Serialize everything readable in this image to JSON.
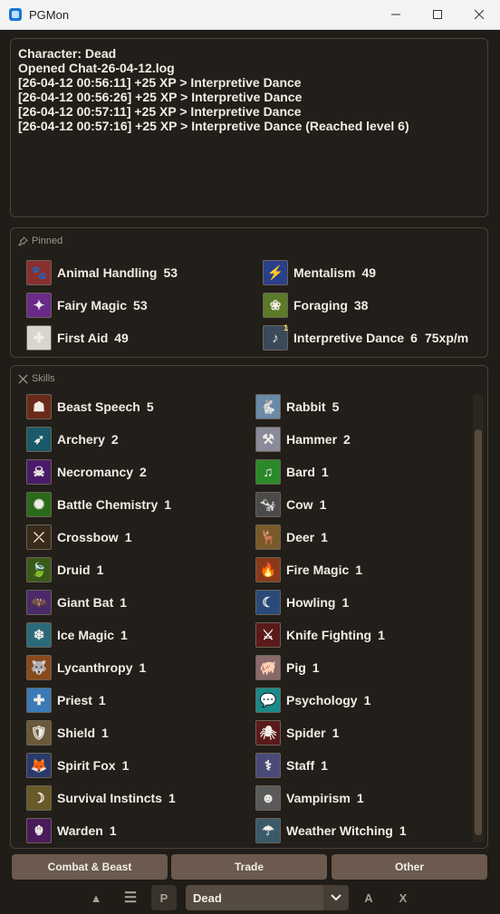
{
  "window": {
    "title": "PGMon"
  },
  "log": {
    "lines": [
      "Character: Dead",
      "Opened Chat-26-04-12.log",
      "[26-04-12 00:56:11] +25 XP > Interpretive Dance",
      "[26-04-12 00:56:26] +25 XP > Interpretive Dance",
      "[26-04-12 00:57:11] +25 XP > Interpretive Dance",
      "[26-04-12 00:57:16] +25 XP > Interpretive Dance (Reached level 6)"
    ]
  },
  "pinned": {
    "title": "Pinned",
    "items": [
      {
        "name": "Animal Handling",
        "level": "53",
        "icon": "animal-handling-icon",
        "color": "#8a2f2f",
        "glyph": "🐾"
      },
      {
        "name": "Mentalism",
        "level": "49",
        "icon": "mentalism-icon",
        "color": "#2a3f8a",
        "glyph": "⚡"
      },
      {
        "name": "Fairy Magic",
        "level": "53",
        "icon": "fairy-magic-icon",
        "color": "#6a2a8a",
        "glyph": "✦"
      },
      {
        "name": "Foraging",
        "level": "38",
        "icon": "foraging-icon",
        "color": "#5b7a2a",
        "glyph": "❀"
      },
      {
        "name": "First Aid",
        "level": "49",
        "icon": "first-aid-icon",
        "color": "#d9d4cc",
        "glyph": "✚"
      },
      {
        "name": "Interpretive Dance",
        "level": "6",
        "rate": "75xp/m",
        "badge": "1",
        "icon": "interpretive-dance-icon",
        "color": "#3a4a5a",
        "glyph": "♪"
      }
    ]
  },
  "skills": {
    "title": "Skills",
    "items": [
      {
        "name": "Beast Speech",
        "level": "5",
        "icon": "beast-speech-icon",
        "color": "#6a2a1a",
        "glyph": "☗"
      },
      {
        "name": "Rabbit",
        "level": "5",
        "icon": "rabbit-icon",
        "color": "#6a8aa8",
        "glyph": "🐇"
      },
      {
        "name": "Archery",
        "level": "2",
        "icon": "archery-icon",
        "color": "#1a5a6a",
        "glyph": "➶"
      },
      {
        "name": "Hammer",
        "level": "2",
        "icon": "hammer-icon",
        "color": "#8a8a9a",
        "glyph": "⚒"
      },
      {
        "name": "Necromancy",
        "level": "2",
        "icon": "necromancy-icon",
        "color": "#4a1a6a",
        "glyph": "☠"
      },
      {
        "name": "Bard",
        "level": "1",
        "icon": "bard-icon",
        "color": "#2a8a2a",
        "glyph": "♫"
      },
      {
        "name": "Battle Chemistry",
        "level": "1",
        "icon": "battle-chemistry-icon",
        "color": "#2a6a1a",
        "glyph": "✺"
      },
      {
        "name": "Cow",
        "level": "1",
        "icon": "cow-icon",
        "color": "#4a4a4a",
        "glyph": "🐄"
      },
      {
        "name": "Crossbow",
        "level": "1",
        "icon": "crossbow-icon",
        "color": "#3a2a1a",
        "glyph": "⤫"
      },
      {
        "name": "Deer",
        "level": "1",
        "icon": "deer-icon",
        "color": "#7a5a2a",
        "glyph": "🦌"
      },
      {
        "name": "Druid",
        "level": "1",
        "icon": "druid-icon",
        "color": "#3a5a1a",
        "glyph": "🍃"
      },
      {
        "name": "Fire Magic",
        "level": "1",
        "icon": "fire-magic-icon",
        "color": "#8a3a1a",
        "glyph": "🔥"
      },
      {
        "name": "Giant Bat",
        "level": "1",
        "icon": "giant-bat-icon",
        "color": "#4a2a6a",
        "glyph": "🦇"
      },
      {
        "name": "Howling",
        "level": "1",
        "icon": "howling-icon",
        "color": "#2a4a7a",
        "glyph": "☾"
      },
      {
        "name": "Ice Magic",
        "level": "1",
        "icon": "ice-magic-icon",
        "color": "#2a6a7a",
        "glyph": "❄"
      },
      {
        "name": "Knife Fighting",
        "level": "1",
        "icon": "knife-fighting-icon",
        "color": "#5a1a1a",
        "glyph": "⚔"
      },
      {
        "name": "Lycanthropy",
        "level": "1",
        "icon": "lycanthropy-icon",
        "color": "#8a4a1a",
        "glyph": "🐺"
      },
      {
        "name": "Pig",
        "level": "1",
        "icon": "pig-icon",
        "color": "#8a6a6a",
        "glyph": "🐖"
      },
      {
        "name": "Priest",
        "level": "1",
        "icon": "priest-icon",
        "color": "#3a7ab8",
        "glyph": "✚"
      },
      {
        "name": "Psychology",
        "level": "1",
        "icon": "psychology-icon",
        "color": "#1a8a8a",
        "glyph": "💬"
      },
      {
        "name": "Shield",
        "level": "1",
        "icon": "shield-icon",
        "color": "#6a5a3a",
        "glyph": "🛡"
      },
      {
        "name": "Spider",
        "level": "1",
        "icon": "spider-icon",
        "color": "#5a1a1a",
        "glyph": "🕷"
      },
      {
        "name": "Spirit Fox",
        "level": "1",
        "icon": "spirit-fox-icon",
        "color": "#2a3a6a",
        "glyph": "🦊"
      },
      {
        "name": "Staff",
        "level": "1",
        "icon": "staff-icon",
        "color": "#4a4a7a",
        "glyph": "⚕"
      },
      {
        "name": "Survival Instincts",
        "level": "1",
        "icon": "survival-instincts-icon",
        "color": "#6a5a2a",
        "glyph": "☽"
      },
      {
        "name": "Vampirism",
        "level": "1",
        "icon": "vampirism-icon",
        "color": "#5a5a5a",
        "glyph": "☻"
      },
      {
        "name": "Warden",
        "level": "1",
        "icon": "warden-icon",
        "color": "#4a1a5a",
        "glyph": "☬"
      },
      {
        "name": "Weather Witching",
        "level": "1",
        "icon": "weather-witching-icon",
        "color": "#3a5a6a",
        "glyph": "☂"
      }
    ]
  },
  "tabs": [
    "Combat & Beast",
    "Trade",
    "Other"
  ],
  "toolbar": {
    "up_glyph": "▲",
    "menu_glyph": "☰",
    "p_label": "P",
    "character_value": "Dead",
    "a_label": "A",
    "x_label": "X"
  },
  "colors": {
    "background": "#201c17",
    "panel_border": "#4a433b",
    "tab_bg": "#6b5a4d",
    "text": "#f1ede6"
  }
}
